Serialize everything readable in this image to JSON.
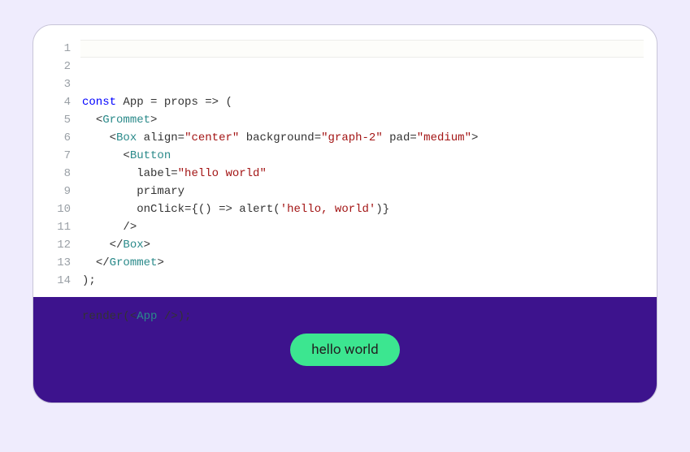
{
  "editor": {
    "line_numbers": [
      "1",
      "2",
      "3",
      "4",
      "5",
      "6",
      "7",
      "8",
      "9",
      "10",
      "11",
      "12",
      "13",
      "14"
    ],
    "highlighted_line": 0,
    "tokens": [
      [
        [
          "kw",
          "const"
        ],
        [
          "plain",
          " App "
        ],
        [
          "punc",
          "="
        ],
        [
          "plain",
          " props "
        ],
        [
          "punc",
          "=>"
        ],
        [
          "plain",
          " "
        ],
        [
          "punc",
          "("
        ]
      ],
      [
        [
          "plain",
          "  "
        ],
        [
          "punc",
          "<"
        ],
        [
          "tag",
          "Grommet"
        ],
        [
          "punc",
          ">"
        ]
      ],
      [
        [
          "plain",
          "    "
        ],
        [
          "punc",
          "<"
        ],
        [
          "tag",
          "Box"
        ],
        [
          "plain",
          " "
        ],
        [
          "attr",
          "align"
        ],
        [
          "punc",
          "="
        ],
        [
          "str",
          "\"center\""
        ],
        [
          "plain",
          " "
        ],
        [
          "attr",
          "background"
        ],
        [
          "punc",
          "="
        ],
        [
          "str",
          "\"graph-2\""
        ],
        [
          "plain",
          " "
        ],
        [
          "attr",
          "pad"
        ],
        [
          "punc",
          "="
        ],
        [
          "str",
          "\"medium\""
        ],
        [
          "punc",
          ">"
        ]
      ],
      [
        [
          "plain",
          "      "
        ],
        [
          "punc",
          "<"
        ],
        [
          "tag",
          "Button"
        ]
      ],
      [
        [
          "plain",
          "        "
        ],
        [
          "attr",
          "label"
        ],
        [
          "punc",
          "="
        ],
        [
          "str",
          "\"hello world\""
        ]
      ],
      [
        [
          "plain",
          "        "
        ],
        [
          "attr",
          "primary"
        ]
      ],
      [
        [
          "plain",
          "        "
        ],
        [
          "attr",
          "onClick"
        ],
        [
          "punc",
          "="
        ],
        [
          "punc",
          "{"
        ],
        [
          "punc",
          "()"
        ],
        [
          "plain",
          " "
        ],
        [
          "punc",
          "=>"
        ],
        [
          "plain",
          " alert"
        ],
        [
          "punc",
          "("
        ],
        [
          "str",
          "'hello, world'"
        ],
        [
          "punc",
          ")"
        ],
        [
          "punc",
          "}"
        ]
      ],
      [
        [
          "plain",
          "      "
        ],
        [
          "punc",
          "/>"
        ]
      ],
      [
        [
          "plain",
          "    "
        ],
        [
          "punc",
          "</"
        ],
        [
          "tag",
          "Box"
        ],
        [
          "punc",
          ">"
        ]
      ],
      [
        [
          "plain",
          "  "
        ],
        [
          "punc",
          "</"
        ],
        [
          "tag",
          "Grommet"
        ],
        [
          "punc",
          ">"
        ]
      ],
      [
        [
          "punc",
          ");"
        ]
      ],
      [
        [
          "plain",
          ""
        ]
      ],
      [
        [
          "plain",
          "render"
        ],
        [
          "punc",
          "("
        ],
        [
          "punc",
          "<"
        ],
        [
          "tag",
          "App"
        ],
        [
          "plain",
          " "
        ],
        [
          "punc",
          "/>"
        ],
        [
          "punc",
          ")"
        ],
        [
          "punc",
          ";"
        ]
      ],
      [
        [
          "plain",
          ""
        ]
      ]
    ]
  },
  "preview": {
    "button_label": "hello world"
  }
}
